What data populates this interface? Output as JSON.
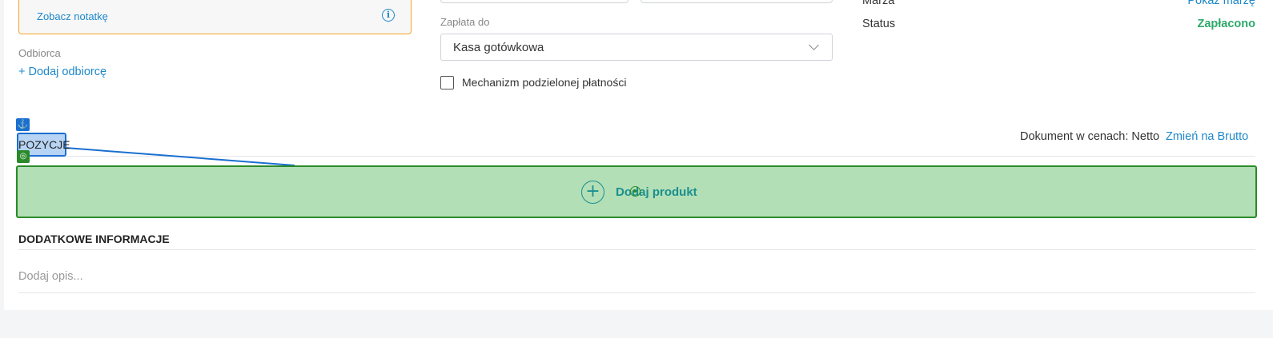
{
  "note": {
    "link_label": "Zobacz notatkę",
    "info_icon": "info-icon"
  },
  "recipient": {
    "label": "Odbiorca",
    "add_label": "+ Dodaj odbiorcę"
  },
  "payment": {
    "label": "Zapłata do",
    "selected": "Kasa gotówkowa",
    "split_payment_label": "Mechanizm podzielonej płatności",
    "split_payment_checked": false
  },
  "summary": {
    "margin_label": "Marża",
    "margin_link": "Pokaż marżę",
    "status_label": "Status",
    "status_value": "Zapłacono",
    "status_color": "#2eaa6a"
  },
  "positions": {
    "badge": "POZYCJE",
    "price_mode_text": "Dokument w cenach: Netto",
    "price_mode_link": "Zmień na Brutto",
    "add_product": "Dodaj produkt"
  },
  "additional": {
    "heading": "DODATKOWE INFORMACJE",
    "description_placeholder": "Dodaj opis..."
  },
  "colors": {
    "accent": "#1e88c9",
    "dropzone_fill": "#b3dfb6",
    "dropzone_border": "#2a8a2a",
    "selection_blue": "#1a6fd0"
  }
}
